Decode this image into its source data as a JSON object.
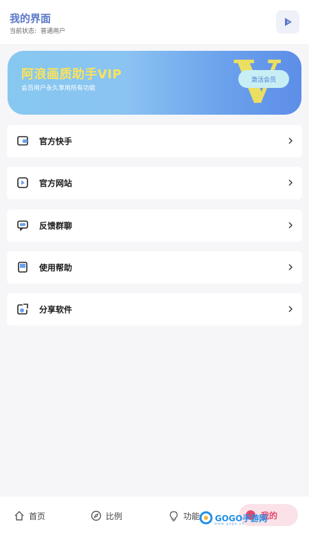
{
  "header": {
    "title": "我的界面",
    "status_label": "当前状态:",
    "status_value": "普通用户"
  },
  "banner": {
    "title": "阿浪画质助手VIP",
    "subtitle": "会员用户永久享用所有功能",
    "activate_label": "激活会员",
    "vip_letter": "V"
  },
  "menu": [
    {
      "label": "官方快手",
      "icon": "folder-icon"
    },
    {
      "label": "官方网站",
      "icon": "play-square-icon"
    },
    {
      "label": "反馈群聊",
      "icon": "chat-icon"
    },
    {
      "label": "使用帮助",
      "icon": "book-icon"
    },
    {
      "label": "分享软件",
      "icon": "share-icon"
    }
  ],
  "tabbar": {
    "tabs": [
      {
        "label": "首页",
        "icon": "home-icon"
      },
      {
        "label": "比例",
        "icon": "compass-icon"
      },
      {
        "label": "功能",
        "icon": "bulb-icon"
      },
      {
        "label": "我的",
        "icon": "profile-icon",
        "active": true
      }
    ]
  },
  "watermark": {
    "text": "GOGO手游网",
    "sub": "www.gogo.cn"
  },
  "colors": {
    "accent": "#5b78c9",
    "active_tab": "#e04a6e",
    "banner_title": "#fbe35a"
  }
}
